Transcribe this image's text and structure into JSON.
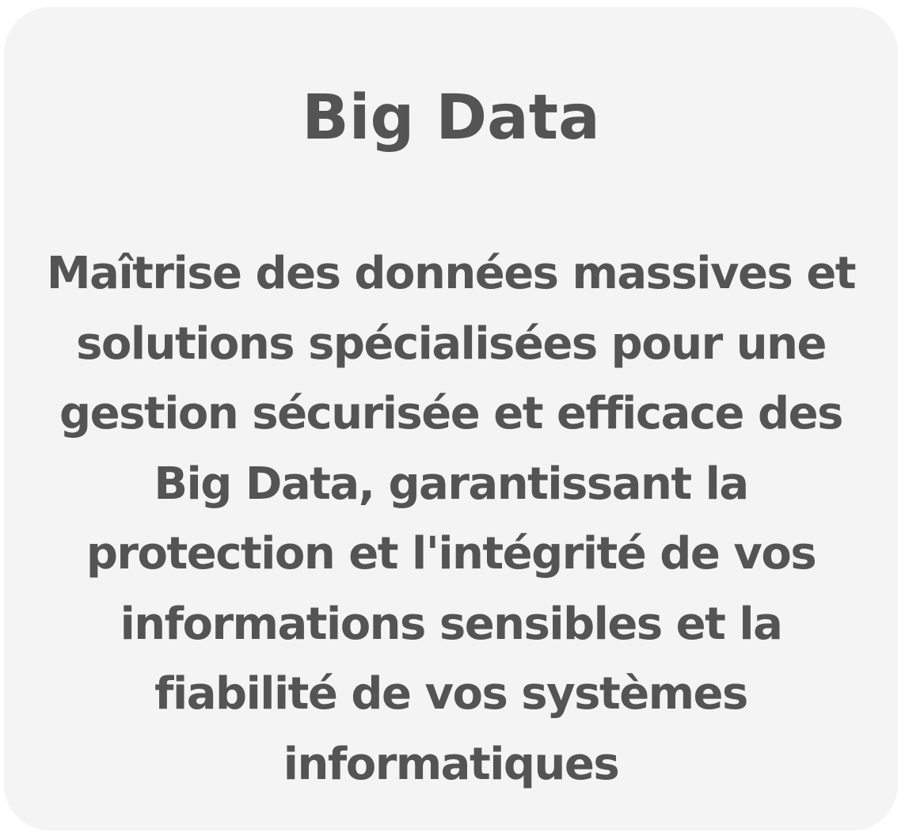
{
  "card": {
    "title": "Big Data",
    "description_lines": [
      "Maîtrise des données massives et",
      "solutions spécialisées pour une",
      "gestion sécurisée et efficace des",
      "Big Data, garantissant la",
      "protection et l'intégrité de vos",
      "informations sensibles et la",
      "fiabilité de vos systèmes",
      "informatiques"
    ],
    "background_color": "#f4f4f4",
    "text_color": "#545454"
  }
}
